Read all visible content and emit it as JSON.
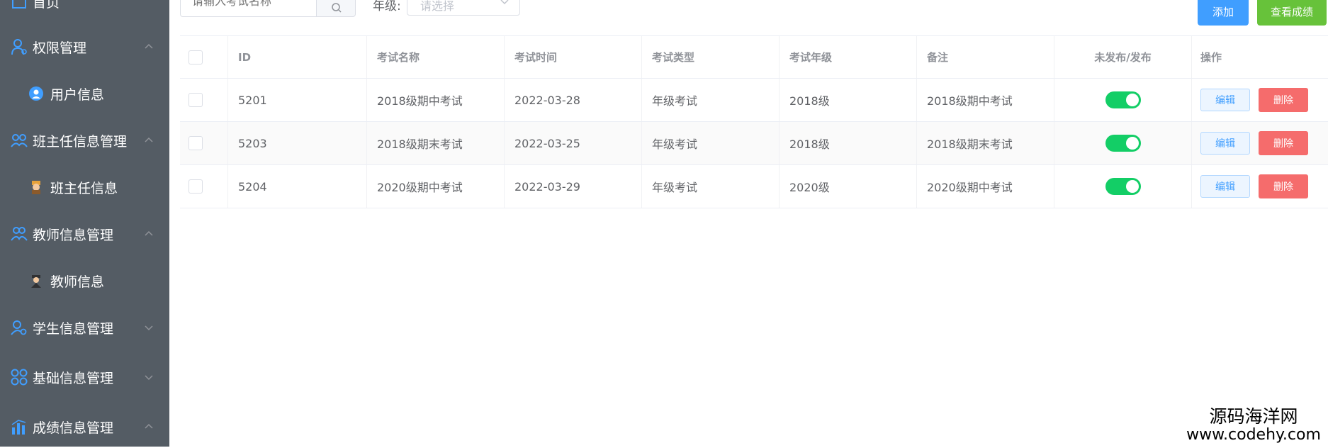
{
  "sidebar": {
    "top_partial": "首页",
    "items": [
      {
        "label": "权限管理",
        "icon": "user-shield-icon",
        "expanded": true,
        "sub": [
          {
            "label": "用户信息",
            "icon": "user-info-icon"
          }
        ]
      },
      {
        "label": "班主任信息管理",
        "icon": "team-icon",
        "expanded": true,
        "sub": [
          {
            "label": "班主任信息",
            "icon": "head-teacher-icon"
          }
        ]
      },
      {
        "label": "教师信息管理",
        "icon": "teachers-icon",
        "expanded": true,
        "sub": [
          {
            "label": "教师信息",
            "icon": "teacher-icon"
          }
        ]
      },
      {
        "label": "学生信息管理",
        "icon": "students-icon",
        "expanded": false
      },
      {
        "label": "基础信息管理",
        "icon": "grid-icon",
        "expanded": false
      },
      {
        "label": "成绩信息管理",
        "icon": "bar-chart-icon",
        "expanded": true
      }
    ]
  },
  "toolbar": {
    "search_placeholder": "请输入考试名称",
    "grade_label": "年级:",
    "grade_placeholder": "请选择",
    "add_label": "添加",
    "view_scores_label": "查看成绩"
  },
  "table": {
    "columns": [
      "ID",
      "考试名称",
      "考试时间",
      "考试类型",
      "考试年级",
      "备注",
      "未发布/发布",
      "操作"
    ],
    "rows": [
      {
        "id": "5201",
        "name": "2018级期中考试",
        "date": "2022-03-28",
        "type": "年级考试",
        "grade": "2018级",
        "remark": "2018级期中考试",
        "published": true
      },
      {
        "id": "5203",
        "name": "2018级期末考试",
        "date": "2022-03-25",
        "type": "年级考试",
        "grade": "2018级",
        "remark": "2018级期末考试",
        "published": true
      },
      {
        "id": "5204",
        "name": "2020级期中考试",
        "date": "2022-03-29",
        "type": "年级考试",
        "grade": "2020级",
        "remark": "2020级期中考试",
        "published": true
      }
    ],
    "edit_label": "编辑",
    "delete_label": "删除"
  },
  "watermark": {
    "cn": "源码海洋网",
    "en": "www.codehy.com"
  },
  "colors": {
    "sidebar": "#545c64",
    "primary": "#409eff",
    "success": "#67c23a",
    "danger": "#f56c6c",
    "switch_on": "#13ce66"
  }
}
